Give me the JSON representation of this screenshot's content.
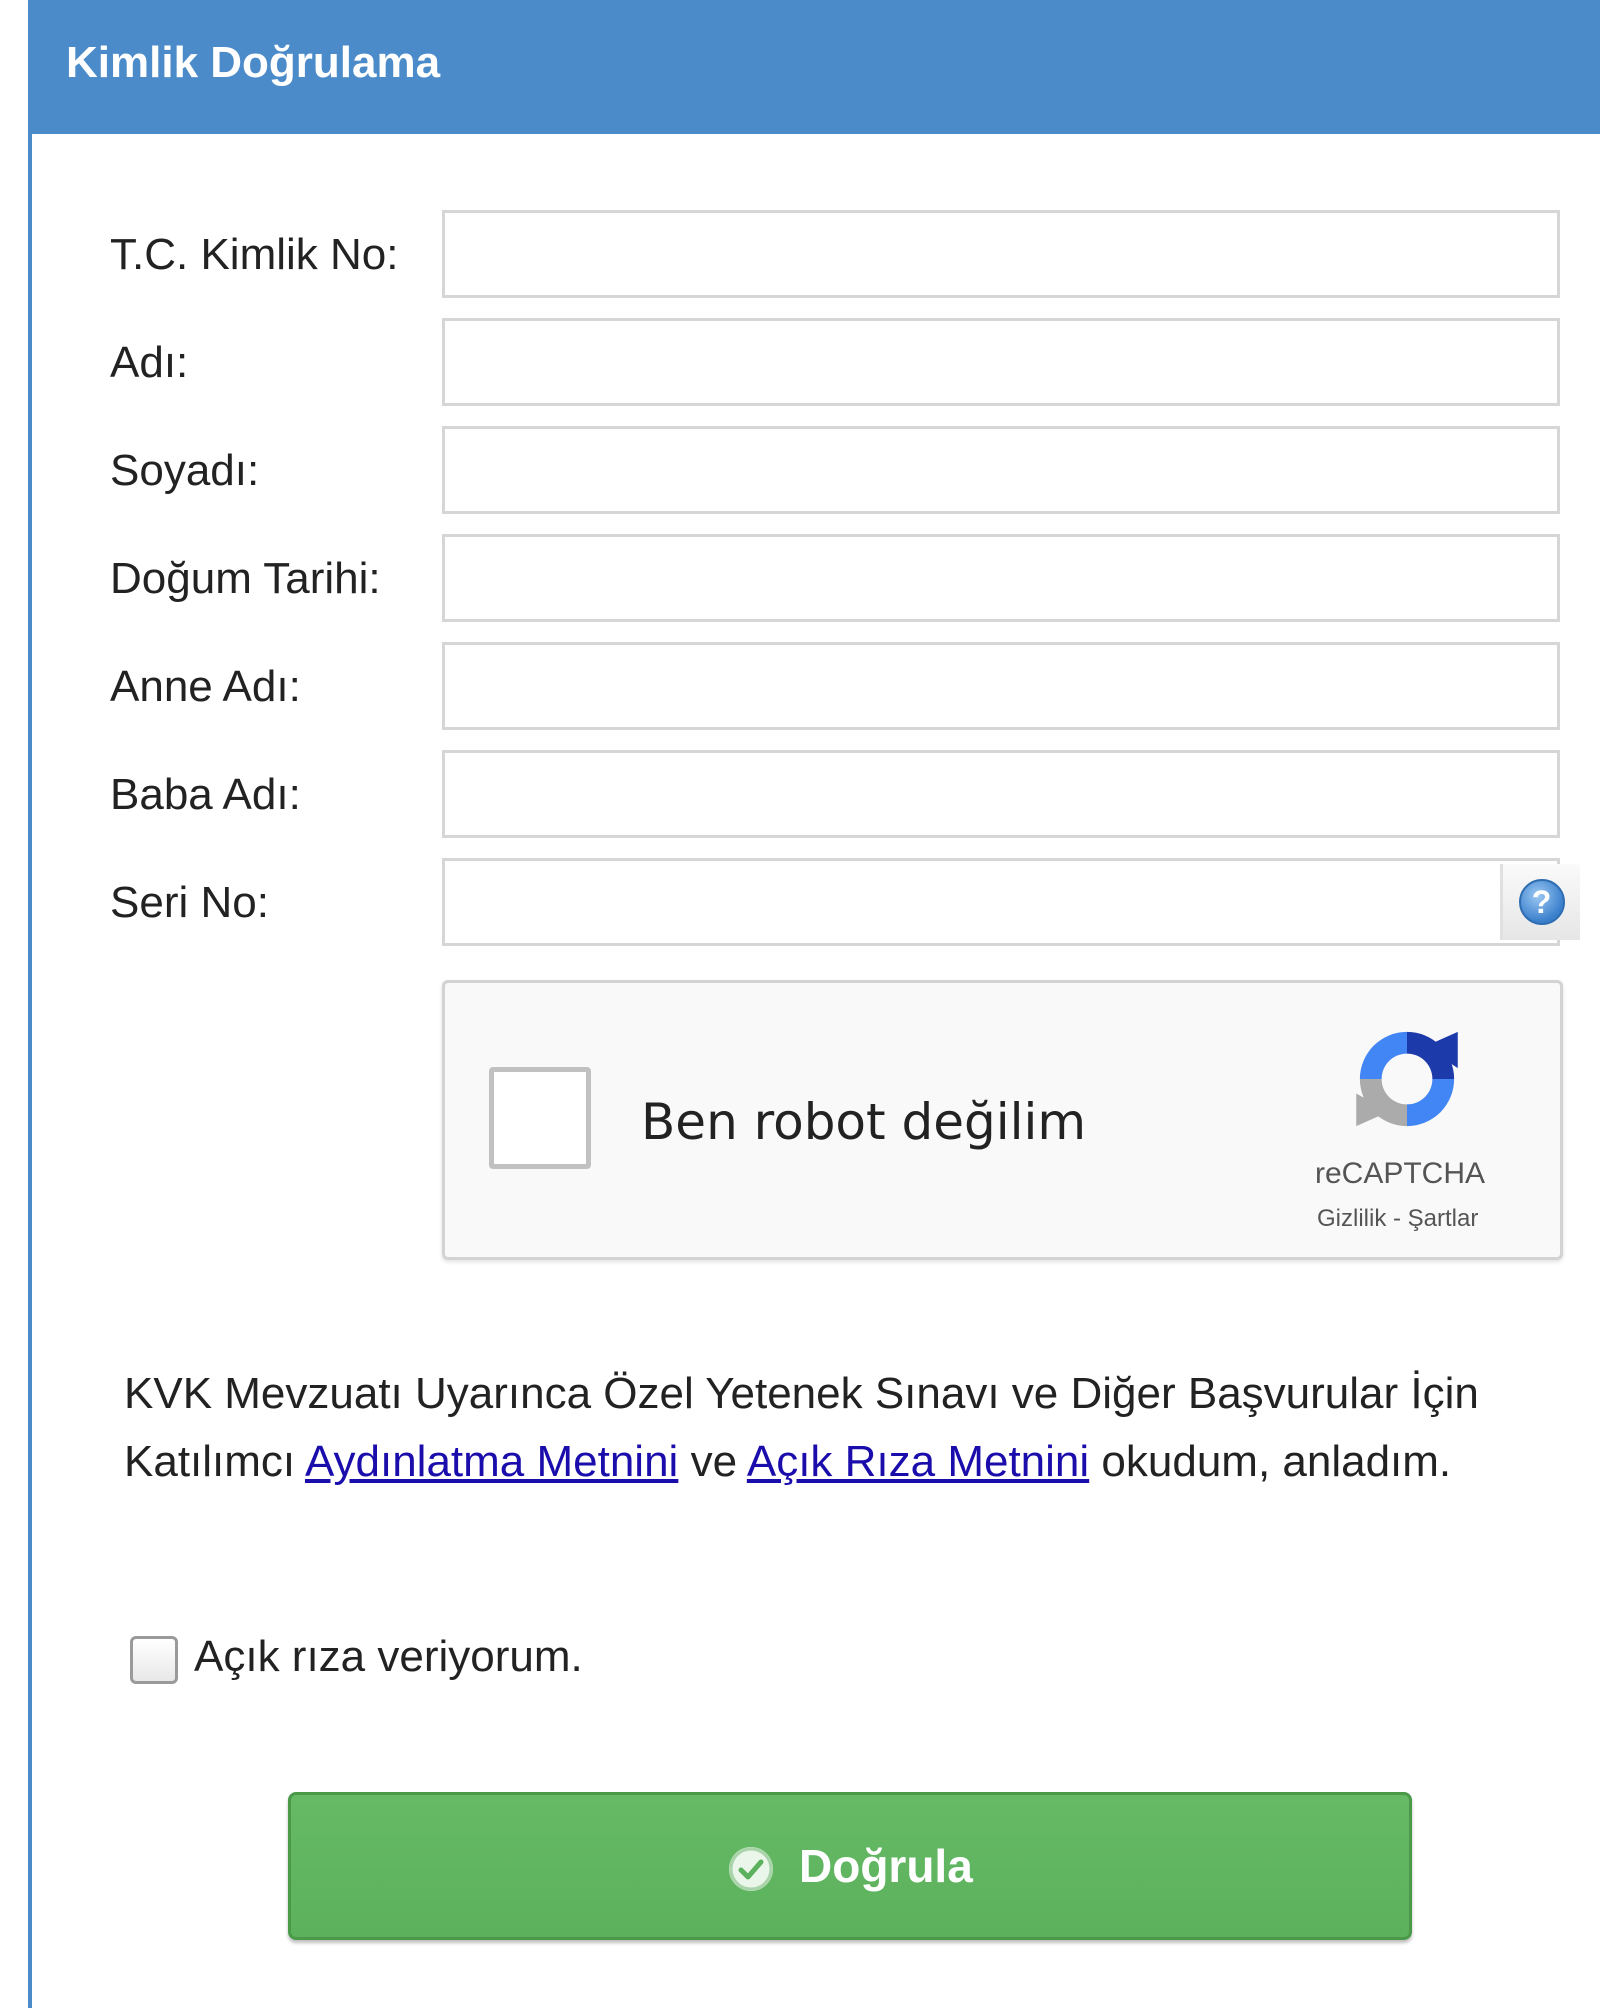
{
  "header": {
    "title": "Kimlik Doğrulama"
  },
  "form": {
    "fields": [
      {
        "label": "T.C. Kimlik No:",
        "value": ""
      },
      {
        "label": "Adı:",
        "value": ""
      },
      {
        "label": "Soyadı:",
        "value": ""
      },
      {
        "label": "Doğum Tarihi:",
        "value": ""
      },
      {
        "label": "Anne Adı:",
        "value": ""
      },
      {
        "label": "Baba Adı:",
        "value": ""
      },
      {
        "label": "Seri No:",
        "value": ""
      }
    ],
    "help_icon": "question-circle-icon"
  },
  "captcha": {
    "label": "Ben robot değilim",
    "brand": "reCAPTCHA",
    "privacy": "Gizlilik",
    "separator": " - ",
    "terms": "Şartlar",
    "logo_icon": "recaptcha-logo-icon",
    "checked": false
  },
  "consent": {
    "text_before": "KVK Mevzuatı Uyarınca Özel Yetenek Sınavı ve Diğer Başvurular İçin Katılımcı ",
    "link1": "Aydınlatma Metnini",
    "text_middle": " ve ",
    "link2": "Açık Rıza Metnini",
    "text_after": " okudum, anladım.",
    "checkbox_label": "Açık rıza veriyorum.",
    "checked": false
  },
  "actions": {
    "verify_label": "Doğrula",
    "verify_icon": "check-circle-icon"
  },
  "colors": {
    "header_bg": "#4b8bc9",
    "button_bg": "#5cb15c",
    "link": "#1a0dab"
  }
}
